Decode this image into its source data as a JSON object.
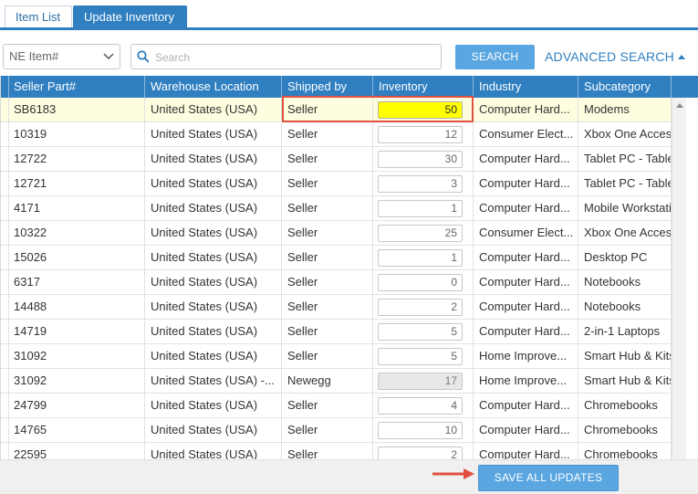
{
  "tabs": [
    {
      "label": "Item List",
      "active": false
    },
    {
      "label": "Update Inventory",
      "active": true
    }
  ],
  "search": {
    "select_value": "NE Item#",
    "placeholder": "Search",
    "search_button": "SEARCH",
    "advanced_link": "ADVANCED SEARCH"
  },
  "grid": {
    "columns": [
      "Seller Part#",
      "Warehouse Location",
      "Shipped by",
      "Inventory",
      "Industry",
      "Subcategory"
    ],
    "rows": [
      {
        "part": "SB6183",
        "warehouse": "United States (USA)",
        "shipped": "Seller",
        "inventory": "50",
        "industry": "Computer Hard...",
        "subcategory": "Modems"
      },
      {
        "part": "10319",
        "warehouse": "United States (USA)",
        "shipped": "Seller",
        "inventory": "12",
        "industry": "Consumer Elect...",
        "subcategory": "Xbox One Accessories"
      },
      {
        "part": "12722",
        "warehouse": "United States (USA)",
        "shipped": "Seller",
        "inventory": "30",
        "industry": "Computer Hard...",
        "subcategory": "Tablet PC - Tablets"
      },
      {
        "part": "12721",
        "warehouse": "United States (USA)",
        "shipped": "Seller",
        "inventory": "3",
        "industry": "Computer Hard...",
        "subcategory": "Tablet PC - Tablets"
      },
      {
        "part": "4171",
        "warehouse": "United States (USA)",
        "shipped": "Seller",
        "inventory": "1",
        "industry": "Computer Hard...",
        "subcategory": "Mobile Workstations"
      },
      {
        "part": "10322",
        "warehouse": "United States (USA)",
        "shipped": "Seller",
        "inventory": "25",
        "industry": "Consumer Elect...",
        "subcategory": "Xbox One Accessories"
      },
      {
        "part": "15026",
        "warehouse": "United States (USA)",
        "shipped": "Seller",
        "inventory": "1",
        "industry": "Computer Hard...",
        "subcategory": "Desktop PC"
      },
      {
        "part": "6317",
        "warehouse": "United States (USA)",
        "shipped": "Seller",
        "inventory": "0",
        "industry": "Computer Hard...",
        "subcategory": "Notebooks"
      },
      {
        "part": "14488",
        "warehouse": "United States (USA)",
        "shipped": "Seller",
        "inventory": "2",
        "industry": "Computer Hard...",
        "subcategory": "Notebooks"
      },
      {
        "part": "14719",
        "warehouse": "United States (USA)",
        "shipped": "Seller",
        "inventory": "5",
        "industry": "Computer Hard...",
        "subcategory": "2-in-1 Laptops"
      },
      {
        "part": "31092",
        "warehouse": "United States (USA)",
        "shipped": "Seller",
        "inventory": "5",
        "industry": "Home Improve...",
        "subcategory": "Smart Hub & Kits"
      },
      {
        "part": "31092",
        "warehouse": "United States (USA) -...",
        "shipped": "Newegg",
        "inventory": "17",
        "industry": "Home Improve...",
        "subcategory": "Smart Hub & Kits"
      },
      {
        "part": "24799",
        "warehouse": "United States (USA)",
        "shipped": "Seller",
        "inventory": "4",
        "industry": "Computer Hard...",
        "subcategory": "Chromebooks"
      },
      {
        "part": "14765",
        "warehouse": "United States (USA)",
        "shipped": "Seller",
        "inventory": "10",
        "industry": "Computer Hard...",
        "subcategory": "Chromebooks"
      },
      {
        "part": "22595",
        "warehouse": "United States (USA)",
        "shipped": "Seller",
        "inventory": "2",
        "industry": "Computer Hard...",
        "subcategory": "Chromebooks"
      }
    ]
  },
  "footer": {
    "save_button": "SAVE ALL UPDATES"
  },
  "colors": {
    "accent": "#2f7fc1",
    "button": "#5aa6e0",
    "highlight": "#ffff00",
    "annotation": "#e05040"
  }
}
